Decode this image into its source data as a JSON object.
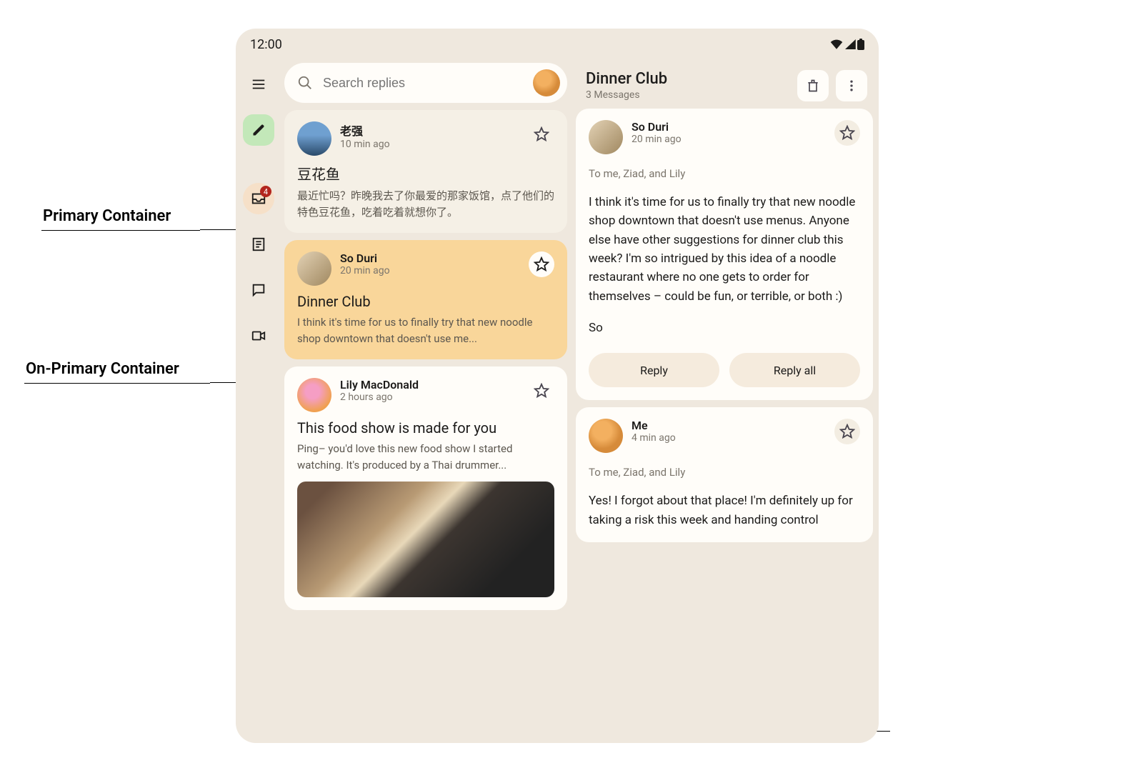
{
  "annotations": {
    "primary": "Primary Container",
    "onPrimary": "On-Primary Container"
  },
  "status": {
    "time": "12:00"
  },
  "search": {
    "placeholder": "Search replies"
  },
  "rail": {
    "inbox_badge": "4"
  },
  "list": [
    {
      "sender": "老强",
      "time": "10 min ago",
      "title": "豆花鱼",
      "body": "最近忙吗？昨晚我去了你最爱的那家饭馆，点了他们的特色豆花鱼，吃着吃着就想你了。"
    },
    {
      "sender": "So Duri",
      "time": "20 min ago",
      "title": "Dinner Club",
      "body": "I think it's time for us to finally try that new noodle shop downtown that doesn't use me..."
    },
    {
      "sender": "Lily MacDonald",
      "time": "2 hours ago",
      "title": "This food show is made for you",
      "body": "Ping– you'd love this new food show I started watching. It's produced by a Thai drummer..."
    }
  ],
  "detail": {
    "title": "Dinner Club",
    "sub": "3 Messages",
    "messages": [
      {
        "sender": "So Duri",
        "time": "20 min ago",
        "recipients": "To me, Ziad, and Lily",
        "body": "I think it's time for us to finally try that new noodle shop downtown that doesn't use menus. Anyone else have other suggestions for dinner club this week? I'm so intrigued by this idea of a noodle restaurant where no one gets to order for themselves – could be fun, or terrible, or both :)",
        "signoff": "So"
      },
      {
        "sender": "Me",
        "time": "4 min ago",
        "recipients": "To me, Ziad, and Lily",
        "body": "Yes! I forgot about that place! I'm definitely up for taking a risk this week and handing control"
      }
    ],
    "reply": "Reply",
    "reply_all": "Reply all"
  }
}
